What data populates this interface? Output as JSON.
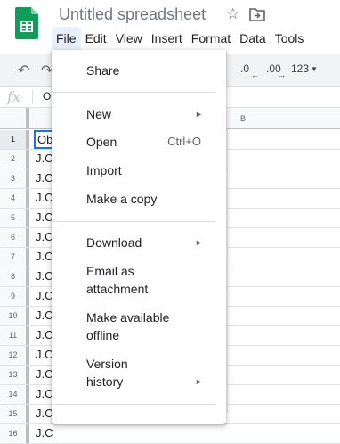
{
  "app": {
    "title": "Untitled spreadsheet",
    "logo": "google-sheets-logo",
    "star_icon": "star-icon",
    "move_icon": "move-to-folder-icon"
  },
  "menubar": {
    "items": [
      {
        "label": "File",
        "active": true
      },
      {
        "label": "Edit"
      },
      {
        "label": "View"
      },
      {
        "label": "Insert"
      },
      {
        "label": "Format"
      },
      {
        "label": "Data"
      },
      {
        "label": "Tools"
      }
    ]
  },
  "toolbar": {
    "undo_icon": "undo-icon",
    "redo_icon": "redo-icon",
    "decrease_decimal": ".0",
    "increase_decimal": ".00",
    "more_formats": "123"
  },
  "formula_bar": {
    "fx": "fx",
    "value": "O"
  },
  "grid": {
    "column_b": "B",
    "rows": [
      {
        "num": "1",
        "a": "Ob"
      },
      {
        "num": "2",
        "a": "J.C"
      },
      {
        "num": "3",
        "a": "J.C"
      },
      {
        "num": "4",
        "a": "J.C"
      },
      {
        "num": "5",
        "a": "J.C"
      },
      {
        "num": "6",
        "a": "J.C"
      },
      {
        "num": "7",
        "a": "J.C"
      },
      {
        "num": "8",
        "a": "J.C"
      },
      {
        "num": "9",
        "a": "J.C"
      },
      {
        "num": "10",
        "a": "J.C"
      },
      {
        "num": "11",
        "a": "J.C"
      },
      {
        "num": "12",
        "a": "J.C"
      },
      {
        "num": "13",
        "a": "J.C"
      },
      {
        "num": "14",
        "a": "J.C"
      },
      {
        "num": "15",
        "a": "J.C"
      },
      {
        "num": "16",
        "a": "J.C"
      }
    ]
  },
  "file_menu": {
    "share": "Share",
    "new": "New",
    "open": "Open",
    "open_shortcut": "Ctrl+O",
    "import": "Import",
    "make_copy": "Make a copy",
    "download": "Download",
    "email_line1": "Email as",
    "email_line2": "attachment",
    "offline_line1": "Make available",
    "offline_line2": "offline",
    "version_line1": "Version",
    "version_line2": "history"
  }
}
